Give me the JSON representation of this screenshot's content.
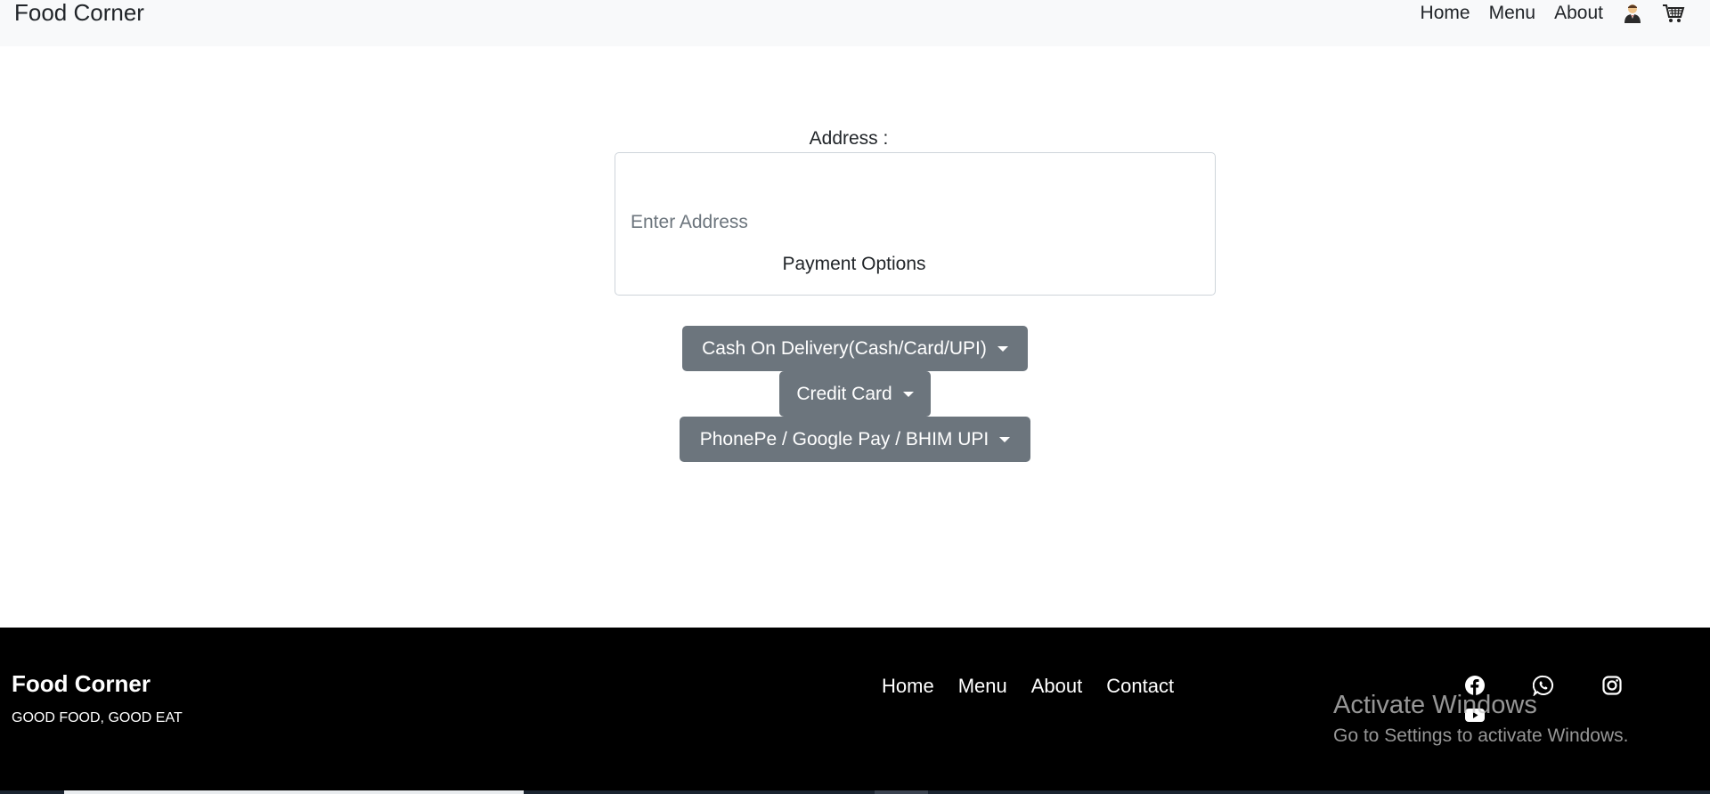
{
  "navbar": {
    "brand": "Food Corner",
    "links": [
      "Home",
      "Menu",
      "About"
    ],
    "icons": [
      "user-icon",
      "cart-icon"
    ]
  },
  "form": {
    "address_label": "Address :",
    "address_placeholder": "Enter Address",
    "payment_label": "Payment Options",
    "options": [
      "Cash On Delivery(Cash/Card/UPI)",
      "Credit Card",
      "PhonePe / Google Pay / BHIM UPI"
    ]
  },
  "footer": {
    "brand": "Food Corner",
    "tagline": "GOOD FOOD, GOOD EAT",
    "links": [
      "Home",
      "Menu",
      "About",
      "Contact"
    ],
    "social": [
      "facebook-icon",
      "whatsapp-icon",
      "instagram-icon",
      "youtube-icon"
    ]
  },
  "watermark": {
    "title": "Activate Windows",
    "subtitle": "Go to Settings to activate Windows."
  },
  "colors": {
    "button_bg": "#6c757d",
    "navbar_bg": "#f8f9fa",
    "footer_bg": "#000000"
  }
}
